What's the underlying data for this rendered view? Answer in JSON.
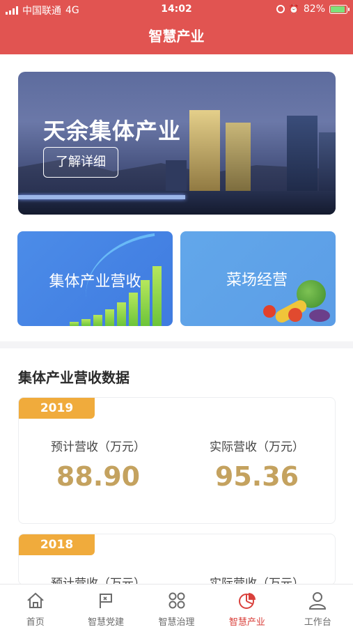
{
  "status_bar": {
    "carrier": "中国联通",
    "network": "4G",
    "time": "14:02",
    "battery": "82%",
    "battery_level": 0.82
  },
  "header": {
    "title": "智慧产业"
  },
  "banner": {
    "title": "天余集体产业",
    "button_label": "了解详细"
  },
  "cards": [
    {
      "label": "集体产业营收",
      "color": "#4c8ce8"
    },
    {
      "label": "菜场经营",
      "color": "#62a7ea"
    }
  ],
  "section": {
    "title": "集体产业营收数据",
    "records": [
      {
        "year": "2019",
        "planned_label": "预计营收（万元）",
        "planned_value": "88.90",
        "actual_label": "实际营收（万元）",
        "actual_value": "95.36"
      },
      {
        "year": "2018",
        "planned_label": "预计营收（万元）",
        "actual_label": "实际营收（万元）"
      }
    ]
  },
  "tabbar": {
    "active": "智慧产业",
    "items": [
      {
        "label": "首页",
        "icon": "home-icon"
      },
      {
        "label": "智慧党建",
        "icon": "flag-icon"
      },
      {
        "label": "智慧治理",
        "icon": "grid-icon"
      },
      {
        "label": "智慧产业",
        "icon": "pie-chart-icon"
      },
      {
        "label": "工作台",
        "icon": "user-icon"
      }
    ]
  },
  "colors": {
    "brand_red": "#e15451",
    "year_badge": "#f0ab3c",
    "value_gold": "#c4a25f",
    "active_tab": "#d9403b"
  }
}
